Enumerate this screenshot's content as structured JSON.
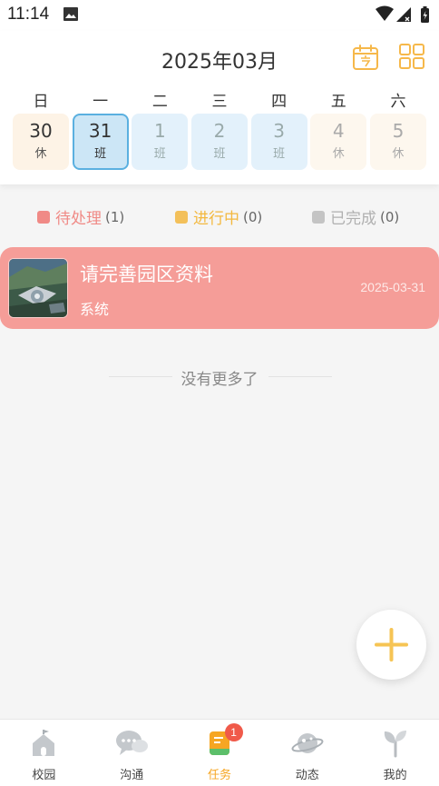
{
  "status_bar": {
    "time": "11:14"
  },
  "header": {
    "month_title": "2025年03月"
  },
  "calendar": {
    "weekdays": [
      "日",
      "一",
      "二",
      "三",
      "四",
      "五",
      "六"
    ],
    "days": [
      {
        "num": "30",
        "tag": "休"
      },
      {
        "num": "31",
        "tag": "班"
      },
      {
        "num": "1",
        "tag": "班"
      },
      {
        "num": "2",
        "tag": "班"
      },
      {
        "num": "3",
        "tag": "班"
      },
      {
        "num": "4",
        "tag": "休"
      },
      {
        "num": "5",
        "tag": "休"
      }
    ]
  },
  "filters": [
    {
      "label": "待处理",
      "count": "(1)",
      "color": "#f08a86"
    },
    {
      "label": "进行中",
      "count": "(0)",
      "color": "#f3c05a"
    },
    {
      "label": "已完成",
      "count": "(0)",
      "color": "#c4c4c4"
    }
  ],
  "task": {
    "title": "请完善园区资料",
    "date": "2025-03-31",
    "source": "系统"
  },
  "list_footer": "没有更多了",
  "tabbar": {
    "items": [
      {
        "label": "校园",
        "icon": "campus-icon"
      },
      {
        "label": "沟通",
        "icon": "chat-icon"
      },
      {
        "label": "任务",
        "icon": "task-icon",
        "badge": "1"
      },
      {
        "label": "动态",
        "icon": "planet-icon"
      },
      {
        "label": "我的",
        "icon": "sprout-icon"
      }
    ]
  },
  "colors": {
    "accent": "#f6a623",
    "task_card": "#f59d98",
    "selected_border": "#5ab0e0"
  }
}
